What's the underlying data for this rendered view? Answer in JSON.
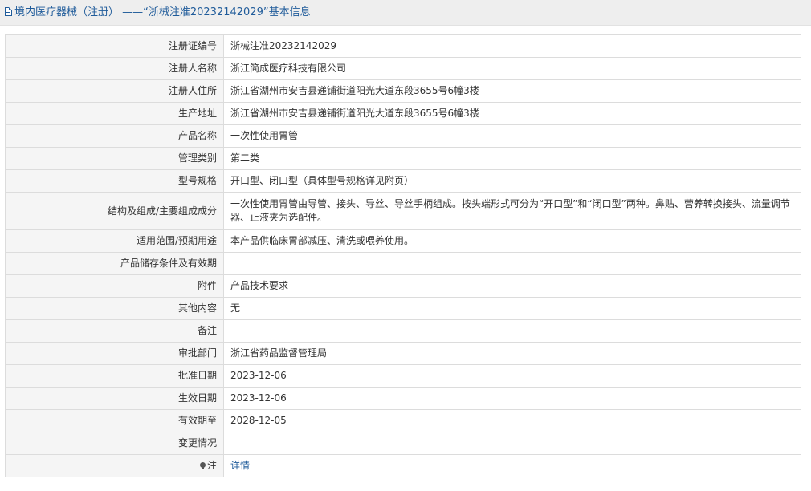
{
  "header": {
    "title": "境内医疗器械（注册） ——“浙械注准20232142029”基本信息"
  },
  "rows": [
    {
      "label": "注册证编号",
      "value": "浙械注准20232142029"
    },
    {
      "label": "注册人名称",
      "value": "浙江简成医疗科技有限公司"
    },
    {
      "label": "注册人住所",
      "value": "浙江省湖州市安吉县递铺街道阳光大道东段3655号6幢3楼"
    },
    {
      "label": "生产地址",
      "value": "浙江省湖州市安吉县递铺街道阳光大道东段3655号6幢3楼"
    },
    {
      "label": "产品名称",
      "value": "一次性使用胃管"
    },
    {
      "label": "管理类别",
      "value": "第二类"
    },
    {
      "label": "型号规格",
      "value": "开口型、闭口型（具体型号规格详见附页）"
    },
    {
      "label": "结构及组成/主要组成成分",
      "value": "一次性使用胃管由导管、接头、导丝、导丝手柄组成。按头端形式可分为“开口型”和“闭口型”两种。鼻贴、营养转换接头、流量调节器、止液夹为选配件。"
    },
    {
      "label": "适用范围/预期用途",
      "value": "本产品供临床胃部减压、清洗或喂养使用。"
    },
    {
      "label": "产品储存条件及有效期",
      "value": ""
    },
    {
      "label": "附件",
      "value": "产品技术要求"
    },
    {
      "label": "其他内容",
      "value": "无"
    },
    {
      "label": "备注",
      "value": ""
    },
    {
      "label": "审批部门",
      "value": "浙江省药品监督管理局"
    },
    {
      "label": "批准日期",
      "value": "2023-12-06"
    },
    {
      "label": "生效日期",
      "value": "2023-12-06"
    },
    {
      "label": "有效期至",
      "value": "2028-12-05"
    },
    {
      "label": "变更情况",
      "value": ""
    }
  ],
  "note": {
    "label": "注",
    "link_text": "详情",
    "icon": "lightbulb-icon"
  },
  "colors": {
    "accent": "#1f5b9a",
    "label_bg": "#f5f5f5",
    "header_bg": "#eeeeee"
  }
}
